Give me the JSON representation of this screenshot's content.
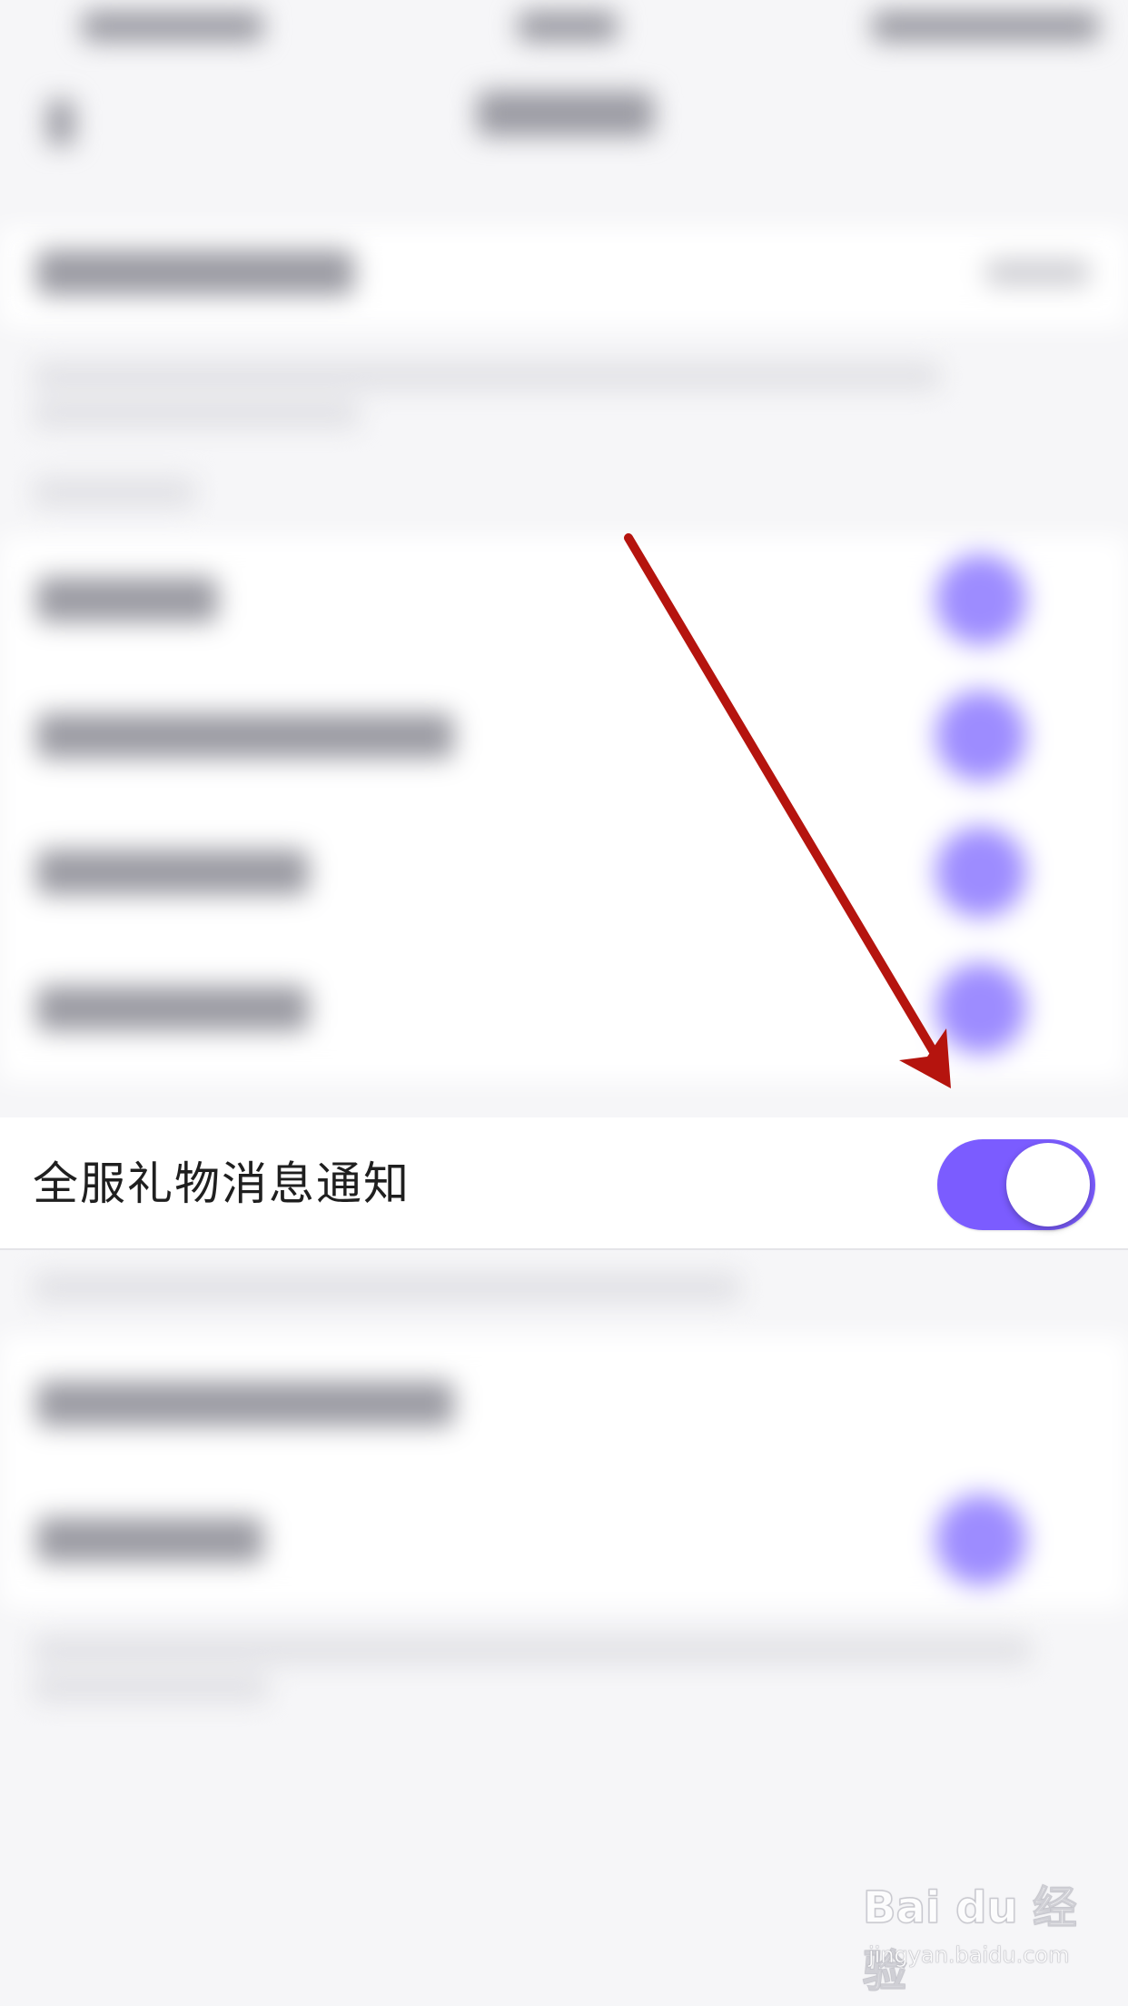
{
  "focused_setting": {
    "label": "全服礼物消息通知",
    "enabled": true
  },
  "colors": {
    "toggle_on": "#7b5cff",
    "arrow": "#b5140e",
    "page_bg": "#f6f6f8"
  },
  "watermark": {
    "logo": "Bai du 经验",
    "url": "jingyan.baidu.com"
  },
  "icons": {
    "arrow": "arrow-annotation-icon",
    "back": "back-chevron-icon"
  }
}
